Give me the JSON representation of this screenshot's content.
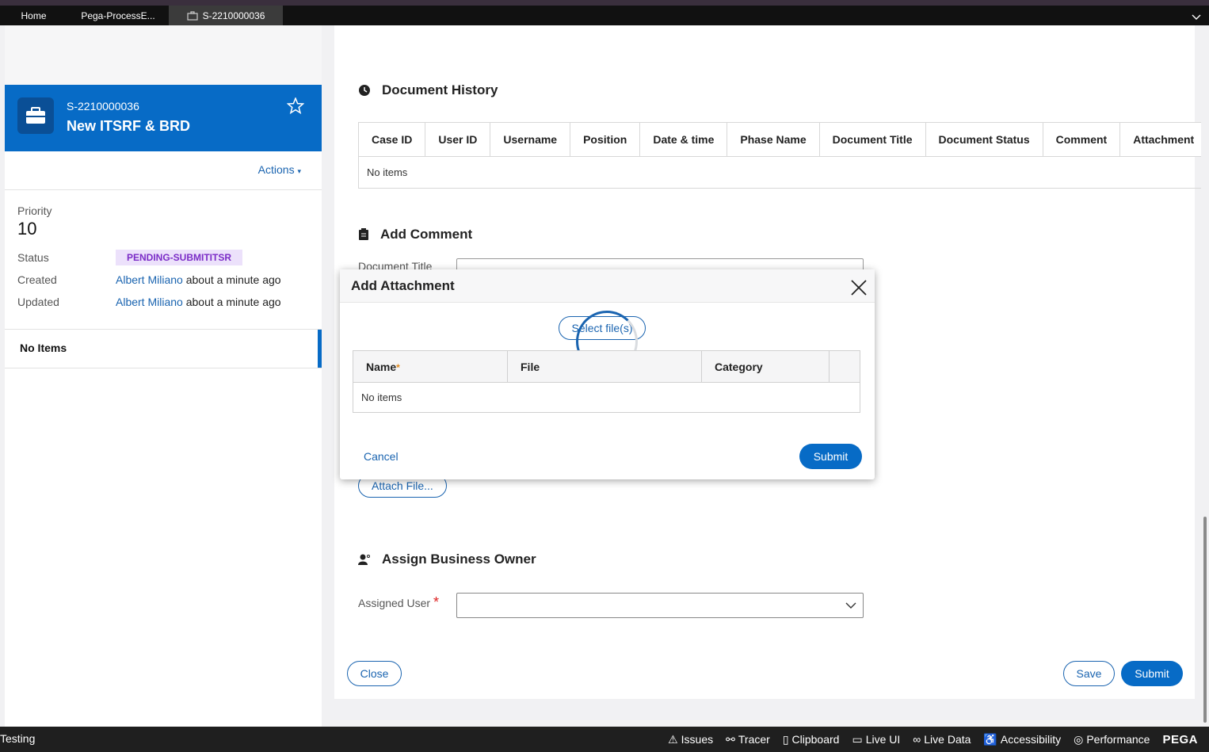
{
  "tabs": {
    "home": "Home",
    "process": "Pega-ProcessE...",
    "active_case": "S-2210000036"
  },
  "case": {
    "id": "S-2210000036",
    "title": "New ITSRF & BRD",
    "actions_label": "Actions",
    "priority_label": "Priority",
    "priority_value": "10",
    "status_label": "Status",
    "status_value": "PENDING-SUBMITITSR",
    "created_label": "Created",
    "created_by": "Albert Miliano",
    "created_when": "about a minute ago",
    "updated_label": "Updated",
    "updated_by": "Albert Miliano",
    "updated_when": "about a minute ago",
    "related_empty": "No Items"
  },
  "document_history": {
    "title": "Document History",
    "columns": [
      "Case ID",
      "User ID",
      "Username",
      "Position",
      "Date & time",
      "Phase Name",
      "Document Title",
      "Document Status",
      "Comment",
      "Attachment"
    ],
    "empty": "No items"
  },
  "add_comment": {
    "title": "Add Comment",
    "document_title_label": "Document Title",
    "attach_label": "Attach File..."
  },
  "assign": {
    "title": "Assign Business Owner",
    "assigned_user_label": "Assigned User",
    "required_mark": "*"
  },
  "footer_buttons": {
    "close": "Close",
    "save": "Save",
    "submit": "Submit"
  },
  "modal": {
    "title": "Add Attachment",
    "select_files": "Select file(s)",
    "columns": [
      "Name",
      "File",
      "Category",
      ""
    ],
    "name_required": "*",
    "empty": "No items",
    "cancel": "Cancel",
    "submit": "Submit"
  },
  "devbar": {
    "label": "Testing",
    "items": [
      "Issues",
      "Tracer",
      "Clipboard",
      "Live UI",
      "Live Data",
      "Accessibility",
      "Performance"
    ],
    "brand": "PEGA"
  },
  "colors": {
    "primary": "#076bc6",
    "link": "#1a64b0",
    "badge_bg": "#ece1fb",
    "badge_text": "#7b2cc7",
    "devbar_bg": "#1f1f1f"
  }
}
